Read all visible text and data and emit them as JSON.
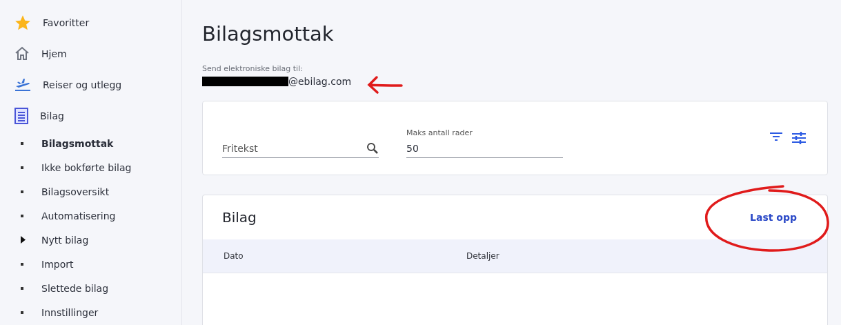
{
  "sidebar": {
    "items": [
      {
        "label": "Favoritter",
        "kind": "star"
      },
      {
        "label": "Hjem",
        "kind": "home"
      },
      {
        "label": "Reiser og utlegg",
        "kind": "plane"
      },
      {
        "label": "Bilag",
        "kind": "list"
      }
    ],
    "sub_items": [
      {
        "label": "Bilagsmottak",
        "kind": "dot",
        "selected": true
      },
      {
        "label": "Ikke bokførte bilag",
        "kind": "dot",
        "selected": false
      },
      {
        "label": "Bilagsoversikt",
        "kind": "dot",
        "selected": false
      },
      {
        "label": "Automatisering",
        "kind": "dot",
        "selected": false
      },
      {
        "label": "Nytt bilag",
        "kind": "arrow",
        "selected": false
      },
      {
        "label": "Import",
        "kind": "dot",
        "selected": false
      },
      {
        "label": "Slettede bilag",
        "kind": "dot",
        "selected": false
      },
      {
        "label": "Innstillinger",
        "kind": "dot",
        "selected": false
      }
    ]
  },
  "page": {
    "title": "Bilagsmottak",
    "email_label": "Send elektroniske bilag til:",
    "email_visible": "@ebilag.com"
  },
  "filters": {
    "search": {
      "placeholder": "Fritekst"
    },
    "max_rows": {
      "label": "Maks antall rader",
      "value": "50"
    }
  },
  "table": {
    "title": "Bilag",
    "upload": "Last opp",
    "columns": [
      "Dato",
      "Detaljer"
    ]
  }
}
